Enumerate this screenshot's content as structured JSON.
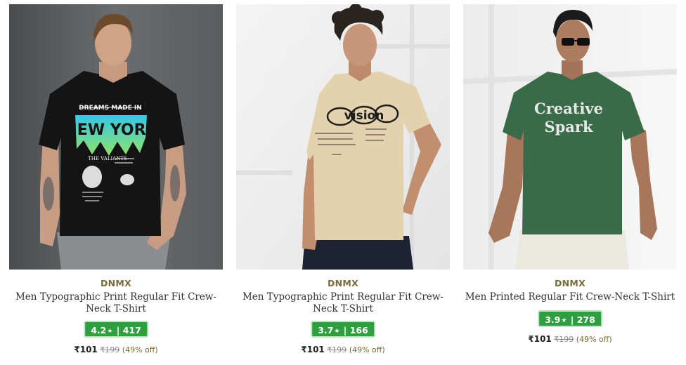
{
  "products": [
    {
      "brand": "DNMX",
      "title": "Men Typographic Print Regular Fit Crew-Neck T-Shirt",
      "rating": "4.2",
      "rating_count": "417",
      "price": "₹101",
      "mrp": "₹199",
      "discount": "(49% off)",
      "shirt_color": "#141414",
      "print_text_1": "DREAMS MADE IN",
      "print_text_2": "NEW YORK",
      "print_text_3": "THE VALIANTS"
    },
    {
      "brand": "DNMX",
      "title": "Men Typographic Print Regular Fit Crew-Neck T-Shirt",
      "rating": "3.7",
      "rating_count": "166",
      "price": "₹101",
      "mrp": "₹199",
      "discount": "(49% off)",
      "shirt_color": "#e3d2ad",
      "print_text_1": "vision"
    },
    {
      "brand": "DNMX",
      "title": "Men Printed Regular Fit Crew-Neck T-Shirt",
      "rating": "3.9",
      "rating_count": "278",
      "price": "₹101",
      "mrp": "₹199",
      "discount": "(49% off)",
      "shirt_color": "#3a6b48",
      "print_text_1": "Creative",
      "print_text_2": "Spark"
    }
  ],
  "labels": {
    "star": "★",
    "separator": "|"
  },
  "colors": {
    "rating_badge": "#2e9e3e",
    "brand_text": "#7a6b36"
  }
}
